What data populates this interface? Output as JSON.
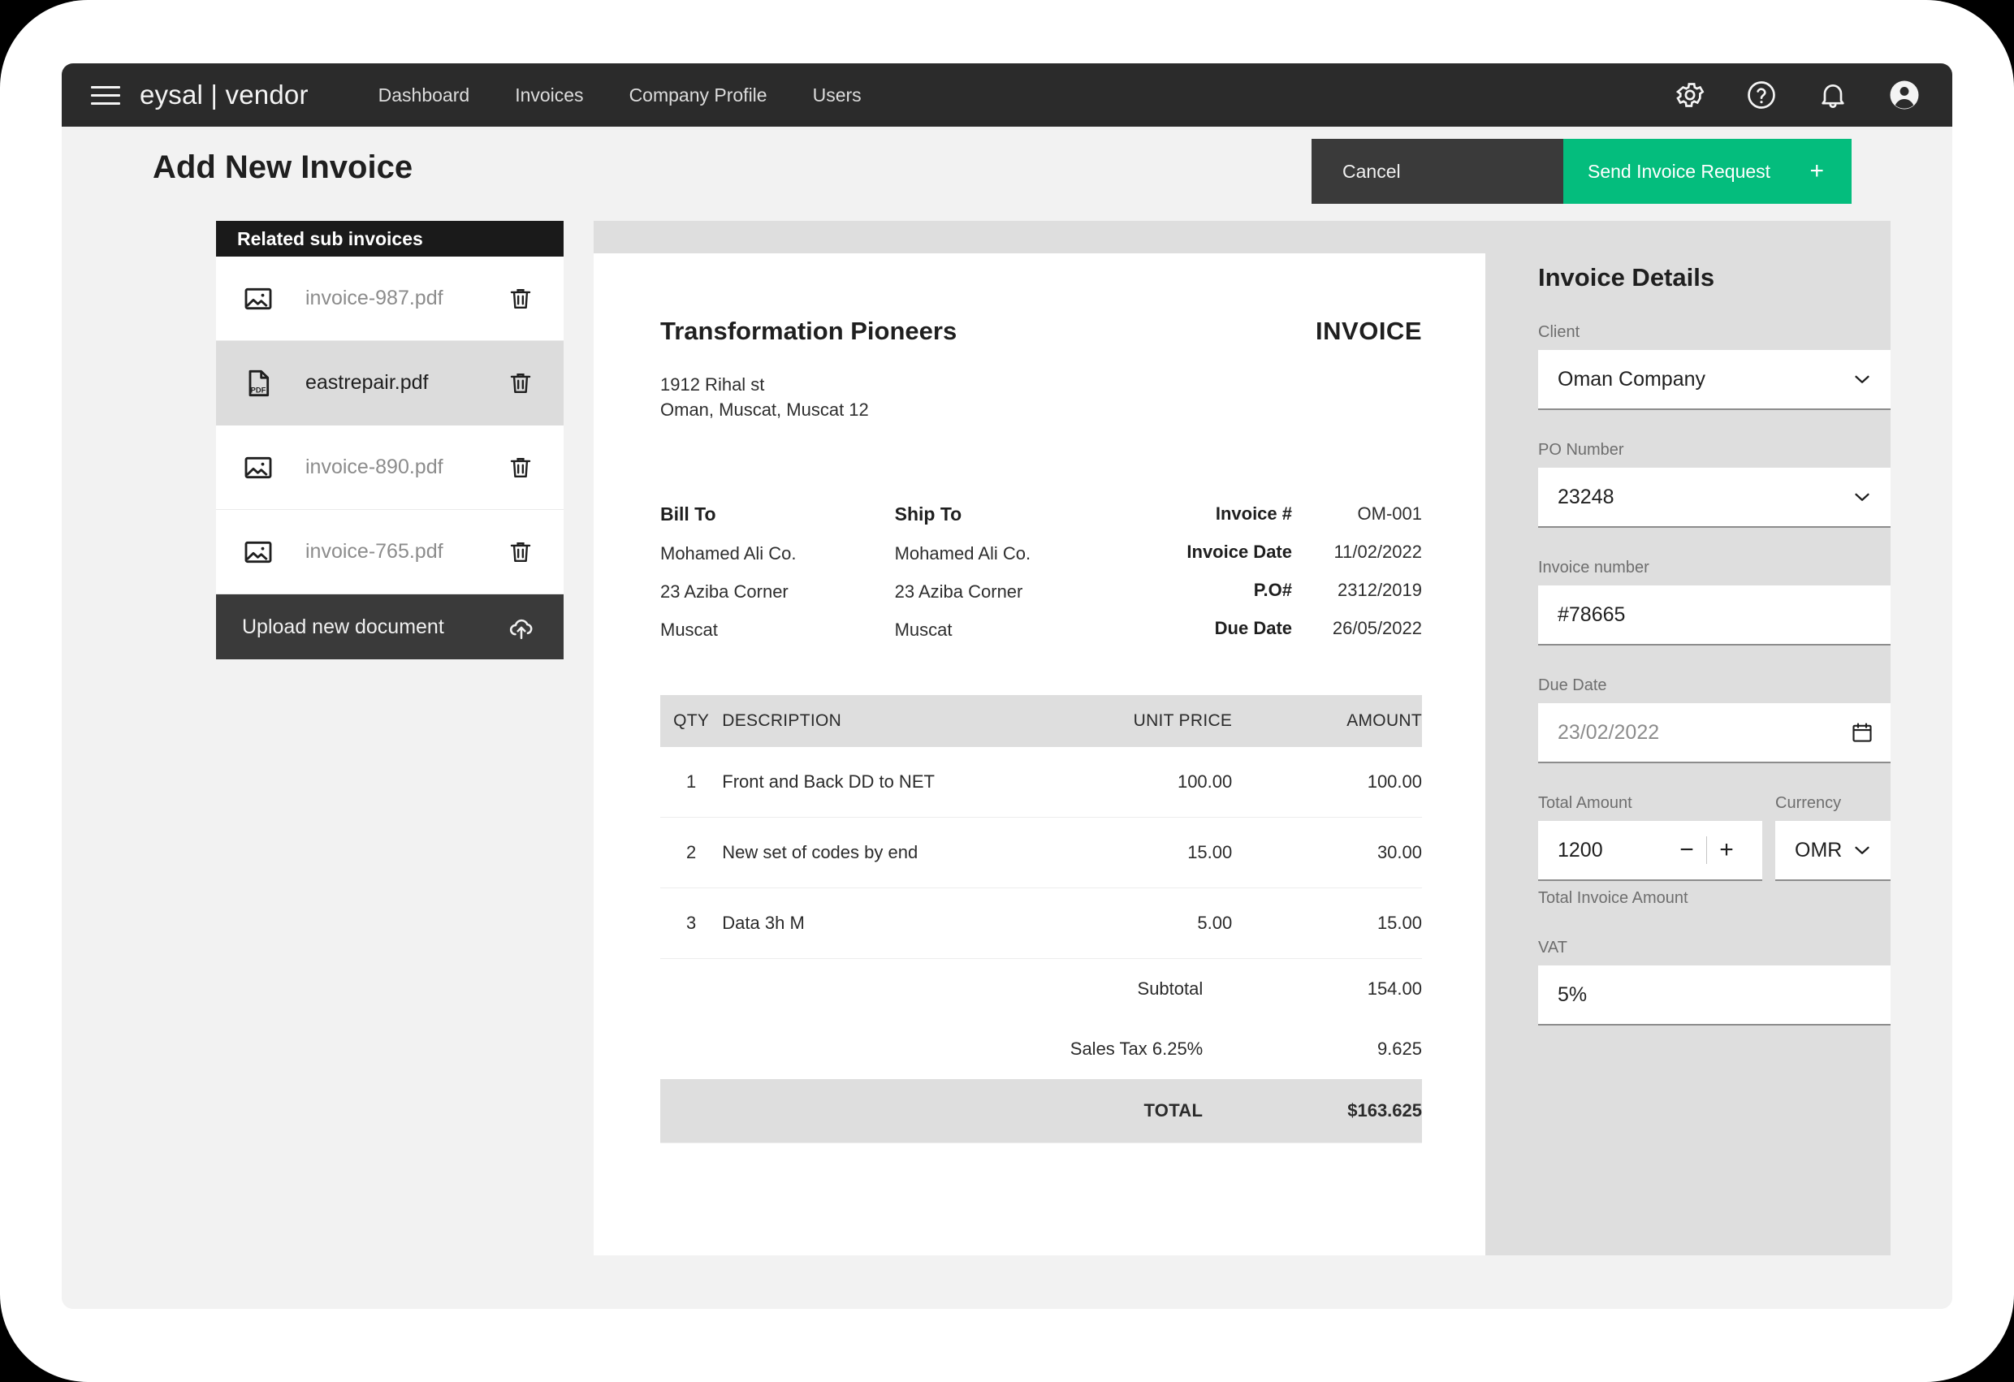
{
  "header": {
    "brand": "eysal | vendor",
    "menu_icon": "hamburger-icon",
    "nav": [
      {
        "label": "Dashboard"
      },
      {
        "label": "Invoices"
      },
      {
        "label": "Company Profile"
      },
      {
        "label": "Users"
      }
    ],
    "icons": [
      {
        "name": "gear-icon"
      },
      {
        "name": "help-circle-icon"
      },
      {
        "name": "bell-icon"
      },
      {
        "name": "account-circle-icon"
      }
    ]
  },
  "page": {
    "title": "Add New Invoice",
    "cancel_label": "Cancel",
    "send_label": "Send Invoice Request",
    "send_plus": "+",
    "accent_green": "#04bd7d",
    "dark": "#3a3a3a"
  },
  "sidebar": {
    "title": "Related sub invoices",
    "files": [
      {
        "name": "invoice-987.pdf",
        "icon": "image-file-icon",
        "selected": false
      },
      {
        "name": "eastrepair.pdf",
        "icon": "pdf-file-icon",
        "selected": true
      },
      {
        "name": "invoice-890.pdf",
        "icon": "image-file-icon",
        "selected": false
      },
      {
        "name": "invoice-765.pdf",
        "icon": "image-file-icon",
        "selected": false
      }
    ],
    "upload_label": "Upload new document",
    "upload_icon": "cloud-upload-icon",
    "delete_icon": "trash-icon"
  },
  "invoice": {
    "company": "Transformation Pioneers",
    "word": "INVOICE",
    "address_line1": "1912 Rihal st",
    "address_line2": "Oman, Muscat, Muscat 12",
    "bill_to": {
      "heading": "Bill To",
      "lines": [
        "Mohamed Ali Co.",
        "23 Aziba Corner",
        "Muscat"
      ]
    },
    "ship_to": {
      "heading": "Ship To",
      "lines": [
        "Mohamed Ali Co.",
        "23 Aziba Corner",
        "Muscat"
      ]
    },
    "meta": [
      {
        "key": "Invoice #",
        "value": "OM-001"
      },
      {
        "key": "Invoice Date",
        "value": "11/02/2022"
      },
      {
        "key": "P.O#",
        "value": "2312/2019"
      },
      {
        "key": "Due Date",
        "value": "26/05/2022"
      }
    ],
    "table": {
      "columns": [
        "QTY",
        "DESCRIPTION",
        "UNIT PRICE",
        "AMOUNT"
      ],
      "rows": [
        {
          "qty": "1",
          "description": "Front and Back DD to NET",
          "unit_price": "100.00",
          "amount": "100.00"
        },
        {
          "qty": "2",
          "description": "New set of codes by end",
          "unit_price": "15.00",
          "amount": "30.00"
        },
        {
          "qty": "3",
          "description": "Data 3h M",
          "unit_price": "5.00",
          "amount": "15.00"
        }
      ],
      "subtotal_label": "Subtotal",
      "subtotal_value": "154.00",
      "tax_label": "Sales Tax 6.25%",
      "tax_value": "9.625",
      "total_label": "TOTAL",
      "total_value": "$163.625"
    }
  },
  "details": {
    "title": "Invoice Details",
    "client": {
      "label": "Client",
      "value": "Oman Company",
      "icon": "chevron-down-icon"
    },
    "po_number": {
      "label": "PO Number",
      "value": "23248",
      "icon": "chevron-down-icon"
    },
    "invoice_number": {
      "label": "Invoice number",
      "value": "#78665"
    },
    "due_date": {
      "label": "Due Date",
      "value": "23/02/2022",
      "icon": "calendar-icon"
    },
    "total_amount": {
      "label": "Total Amount",
      "value": "1200",
      "minus": "−",
      "plus": "+"
    },
    "currency": {
      "label": "Currency",
      "value": "OMR",
      "icon": "chevron-down-icon"
    },
    "total_hint": "Total Invoice Amount",
    "vat": {
      "label": "VAT",
      "value": "5%"
    }
  }
}
